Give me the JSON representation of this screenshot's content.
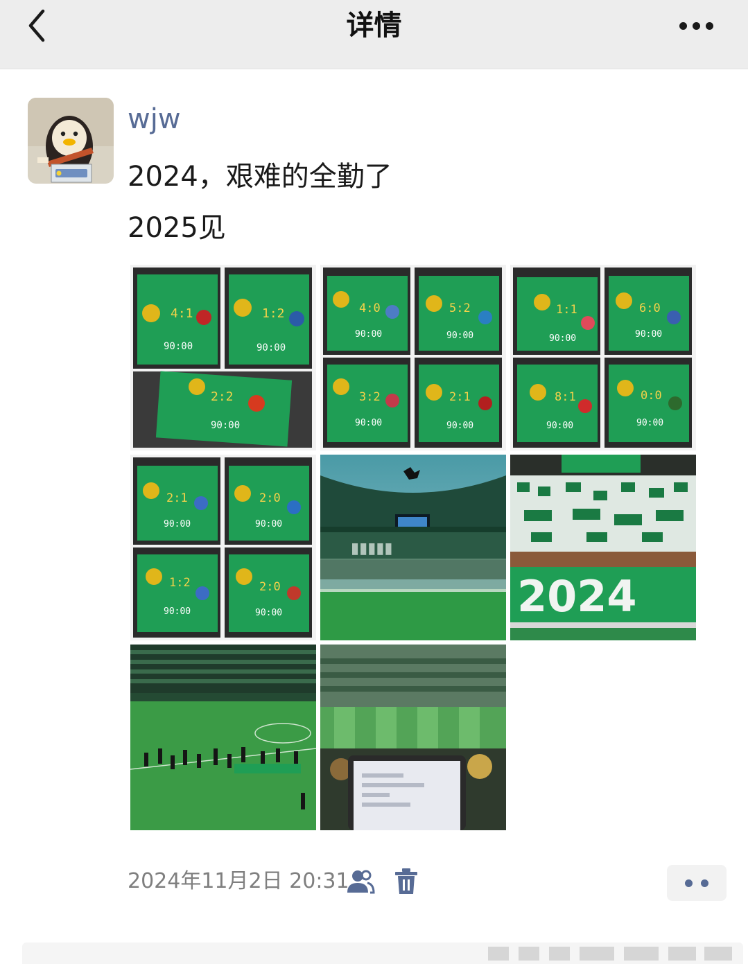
{
  "navbar": {
    "title": "详情",
    "back_icon": "chevron-left-icon",
    "more_icon": "ellipsis-icon"
  },
  "post": {
    "username": "wjw",
    "text_lines": [
      "2024，艰难的全勤了",
      "2025见"
    ],
    "images": [
      {
        "label": "scoreboard-collage-1",
        "kind": "scoreboard-collage"
      },
      {
        "label": "scoreboard-collage-2",
        "kind": "scoreboard-collage"
      },
      {
        "label": "scoreboard-collage-3",
        "kind": "scoreboard-collage"
      },
      {
        "label": "scoreboard-collage-4",
        "kind": "scoreboard-collage"
      },
      {
        "label": "stadium-banner-photo",
        "kind": "stadium"
      },
      {
        "label": "stadium-tifo-2024-photo",
        "kind": "tifo"
      },
      {
        "label": "players-on-pitch-photo",
        "kind": "pitch"
      },
      {
        "label": "stands-with-laptop-photo",
        "kind": "laptop"
      }
    ],
    "timestamp": "2024年11月2日 20:31",
    "visibility_icon": "friends-visibility-icon",
    "delete_icon": "trash-icon",
    "comment_icon": "comment-more-icon"
  },
  "colors": {
    "accent": "#576b95",
    "navbar_bg": "#ededed",
    "scoreboard_green": "#1f9e55"
  }
}
